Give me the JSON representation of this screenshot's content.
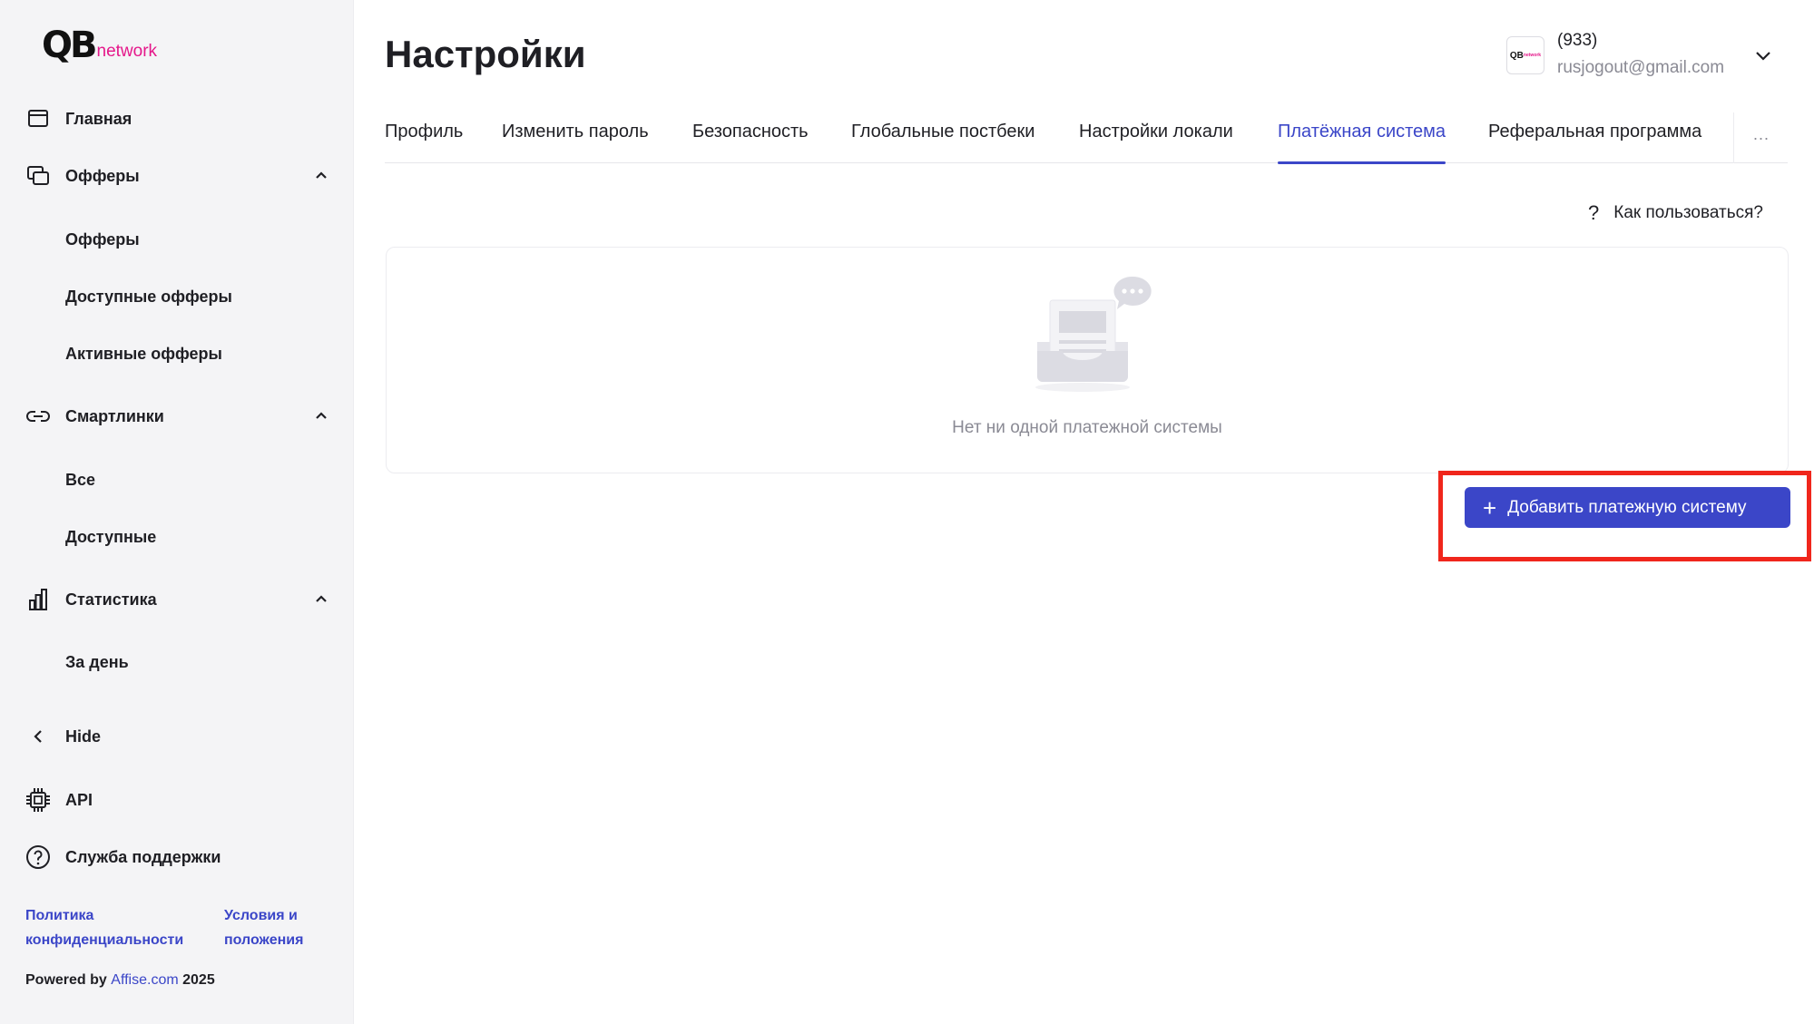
{
  "logo": {
    "mark": "QB",
    "suffix": "network"
  },
  "sidebar": {
    "items": [
      {
        "label": "Главная",
        "icon": "home-window-icon"
      },
      {
        "label": "Офферы",
        "icon": "offers-stack-icon",
        "expanded": true,
        "children": [
          "Офферы",
          "Доступные офферы",
          "Активные офферы"
        ]
      },
      {
        "label": "Смартлинки",
        "icon": "link-icon",
        "expanded": true,
        "children": [
          "Все",
          "Доступные"
        ]
      },
      {
        "label": "Статистика",
        "icon": "bar-chart-icon",
        "expanded": true,
        "children": [
          "За день"
        ]
      }
    ],
    "hide_label": "Hide",
    "api_label": "API",
    "support_label": "Служба поддержки",
    "footer": {
      "privacy_line1": "Политика",
      "privacy_line2": "конфиденциальности",
      "terms_line1": "Условия и",
      "terms_line2": "положения",
      "powered_prefix": "Powered by",
      "powered_link": "Affise.com",
      "powered_year": "2025"
    }
  },
  "header": {
    "title": "Настройки",
    "user": {
      "name": "(933)",
      "email": "rusjogout@gmail.com",
      "avatar_text": "QB",
      "avatar_suffix": "network"
    }
  },
  "tabs": [
    {
      "label": "Профиль",
      "active": false
    },
    {
      "label": "Изменить пароль",
      "active": false
    },
    {
      "label": "Безопасность",
      "active": false
    },
    {
      "label": "Глобальные постбеки",
      "active": false
    },
    {
      "label": "Настройки локали",
      "active": false
    },
    {
      "label": "Платёжная система",
      "active": true
    },
    {
      "label": "Реферальная программа",
      "active": false
    }
  ],
  "tabs_more": "···",
  "help": {
    "icon": "?",
    "label": "Как пользоваться?"
  },
  "empty_state": {
    "text": "Нет ни одной платежной системы",
    "icon": "empty-inbox-icon"
  },
  "add_button": {
    "icon": "+",
    "label": "Добавить платежную систему"
  },
  "colors": {
    "accent": "#3b46c8",
    "brand_pink": "#e5178a",
    "highlight": "#f0261c",
    "sidebar_bg": "#f4f4f6"
  }
}
